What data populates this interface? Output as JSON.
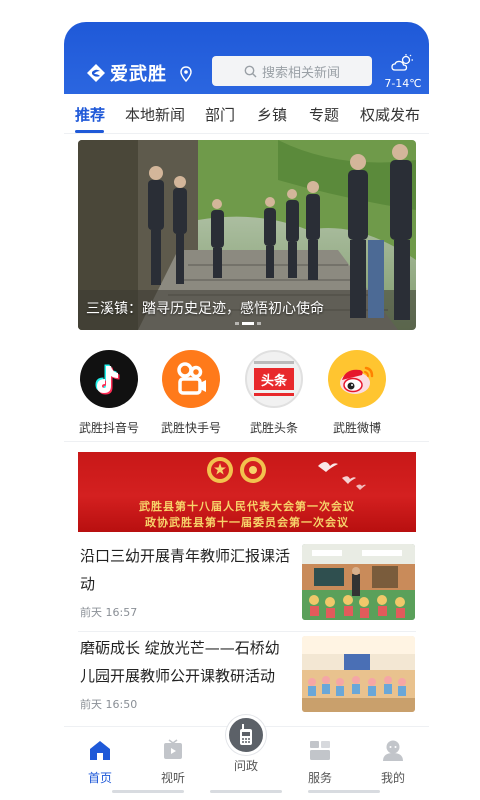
{
  "header": {
    "app_name": "爱武胜",
    "search_placeholder": "搜索相关新闻",
    "weather": "7-14℃",
    "accent_color": "#1f59d8"
  },
  "tabs": [
    {
      "label": "推荐",
      "active": true
    },
    {
      "label": "本地新闻"
    },
    {
      "label": "部门"
    },
    {
      "label": "乡镇"
    },
    {
      "label": "专题"
    },
    {
      "label": "权威发布"
    }
  ],
  "banner": {
    "caption": "三溪镇：踏寻历史足迹，感悟初心使命"
  },
  "shortcuts": [
    {
      "label": "武胜抖音号",
      "icon": "douyin-icon"
    },
    {
      "label": "武胜快手号",
      "icon": "kuaishou-icon"
    },
    {
      "label": "武胜头条",
      "icon": "toutiao-icon",
      "icon_text": "头条"
    },
    {
      "label": "武胜微博",
      "icon": "weibo-icon"
    }
  ],
  "ad_banner": {
    "line1": "武胜县第十八届人民代表大会第一次会议",
    "line2": "政协武胜县第十一届委员会第一次会议"
  },
  "news": [
    {
      "title": "沿口三幼开展青年教师汇报课活动",
      "time": "前天 16:57"
    },
    {
      "title": "磨砺成长 绽放光芒——石桥幼儿园开展教师公开课教研活动",
      "time": "前天 16:50"
    }
  ],
  "bottom_nav": [
    {
      "label": "首页",
      "icon": "home-icon",
      "active": true
    },
    {
      "label": "视听",
      "icon": "tv-icon"
    },
    {
      "label": "问政",
      "icon": "walkie-talkie-icon"
    },
    {
      "label": "服务",
      "icon": "service-icon"
    },
    {
      "label": "我的",
      "icon": "user-icon"
    }
  ]
}
